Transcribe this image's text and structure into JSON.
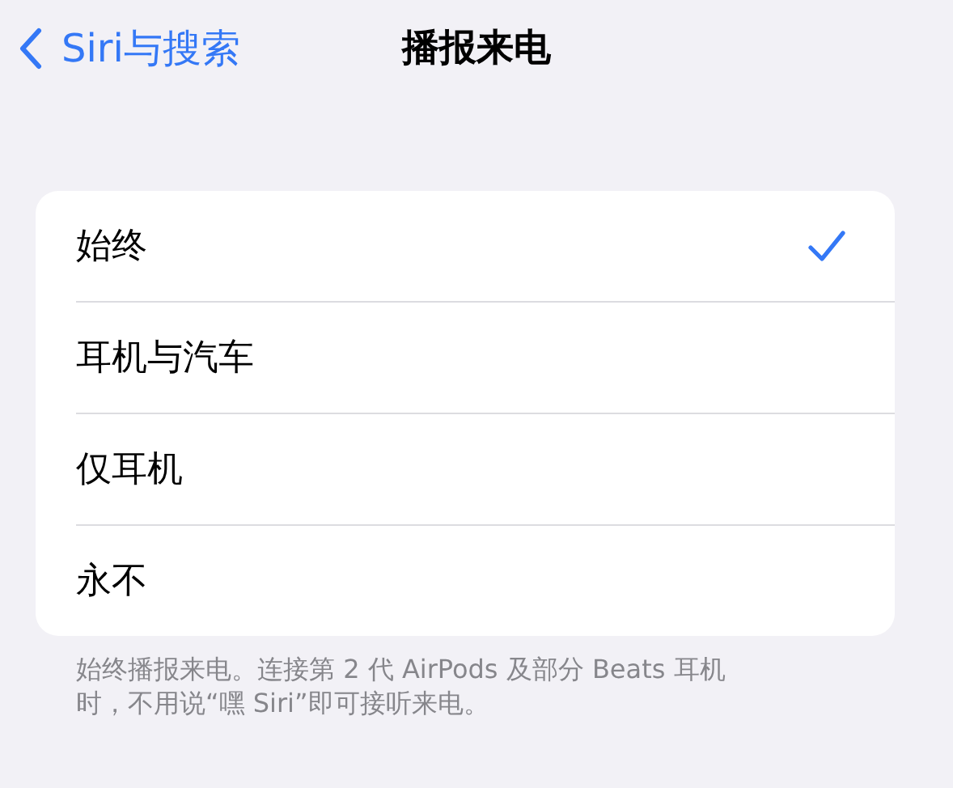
{
  "nav": {
    "back_label": "Siri与搜索",
    "title": "播报来电"
  },
  "options": [
    {
      "label": "始终",
      "selected": true
    },
    {
      "label": "耳机与汽车",
      "selected": false
    },
    {
      "label": "仅耳机",
      "selected": false
    },
    {
      "label": "永不",
      "selected": false
    }
  ],
  "footer": "始终播报来电。连接第 2 代 AirPods 及部分 Beats 耳机时，不用说“嘿 Siri”即可接听来电。"
}
